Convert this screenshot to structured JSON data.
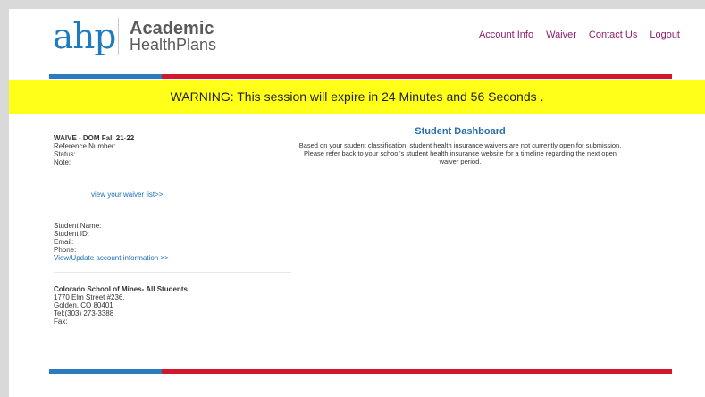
{
  "header": {
    "logo_mark": "ahp",
    "logo_line1": "Academic",
    "logo_line2": "HealthPlans",
    "nav": [
      "Account Info",
      "Waiver",
      "Contact Us",
      "Logout"
    ]
  },
  "warning": {
    "text": "WARNING: This session will expire in 24 Minutes and 56 Seconds ."
  },
  "waiver": {
    "title": "WAIVE - DOM Fall 21-22",
    "reference_label": "Reference Number:",
    "status_label": "Status:",
    "note_label": "Note:",
    "list_link": "view your waiver list>>"
  },
  "student": {
    "name_label": "Student Name:",
    "id_label": "Student ID:",
    "email_label": "Email:",
    "phone_label": "Phone:",
    "update_link": "View/Update account information >>"
  },
  "school": {
    "name": "Colorado School of Mines- All Students",
    "address1": "1770 Elm Street #236,",
    "address2": "Golden, CO 80401",
    "tel": "Tel:(303) 273-3388",
    "fax": "Fax:"
  },
  "dashboard": {
    "title": "Student Dashboard",
    "message": "Based on your student classification, student health insurance waivers are not currently open for submission. Please refer back to your school's student health insurance website for a timeline regarding the next open waiver period."
  },
  "colors": {
    "brand_blue": "#1e7bbf",
    "nav_purple": "#8e1b6d",
    "warning_yellow": "#ffff1a",
    "rule_red": "#d3172e"
  }
}
